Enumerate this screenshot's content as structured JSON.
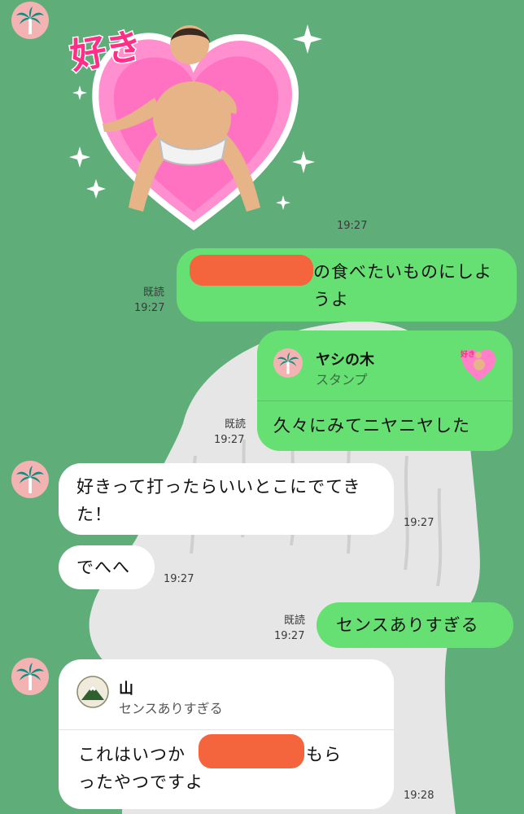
{
  "colors": {
    "background": "#5fae7a",
    "outgoing_bubble": "#66e073",
    "incoming_bubble": "#ffffff",
    "redaction": "#f4653d",
    "avatar_bg": "#f4b3b3"
  },
  "sticker": {
    "text": "好き",
    "time": "19:27",
    "icon": "heart-sumo-sticker"
  },
  "messages": {
    "m1": {
      "text": "の食べたいものにしようよ",
      "read": "既読",
      "time": "19:27"
    },
    "m2": {
      "reply_name": "ヤシの木",
      "reply_sub": "スタンプ",
      "text": "久々にみてニヤニヤした",
      "read": "既読",
      "time": "19:27"
    },
    "m3": {
      "text": "好きって打ったらいいとこにでてきた！",
      "time": "19:27"
    },
    "m4": {
      "text": "でへへ",
      "time": "19:27"
    },
    "m5": {
      "text": "センスありすぎる",
      "read": "既読",
      "time": "19:27"
    },
    "m6": {
      "reply_name": "山",
      "reply_sub": "センスありすぎる",
      "text": "これはいつか",
      "text2": "んにもら",
      "text3": "ったやつですよ",
      "time": "19:28"
    }
  },
  "icons": {
    "avatar": "palm-tree-icon",
    "mountain": "mountain-icon"
  }
}
